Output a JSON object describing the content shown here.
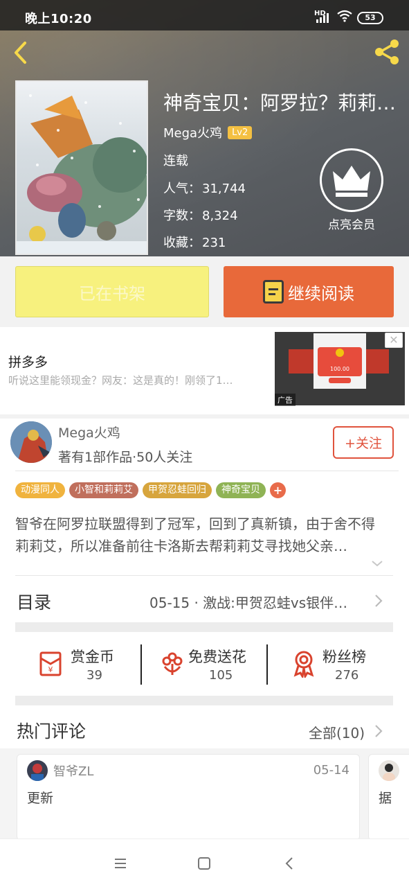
{
  "status_bar": {
    "time": "晚上10:20",
    "network": "HD",
    "battery": "53"
  },
  "book": {
    "title": "神奇宝贝：阿罗拉？莉莉…",
    "author": "Mega火鸡",
    "level": "Lv2",
    "status": "连载",
    "popularity_label": "人气：",
    "popularity": "31,744",
    "words_label": "字数：",
    "words": "8,324",
    "favorites_label": "收藏：",
    "favorites": "231",
    "vip_label": "点亮会员"
  },
  "actions": {
    "shelf_label": "已在书架",
    "read_label": "继续阅读"
  },
  "ad": {
    "title": "拼多多",
    "description": "听说这里能领现金？网友：这是真的！刚领了1…",
    "tag": "广告",
    "amount": "100.00"
  },
  "author_card": {
    "name": "Mega火鸡",
    "subtitle": "著有1部作品·50人关注",
    "follow_label": "+关注"
  },
  "tags": [
    {
      "label": "动漫同人",
      "color": "#f0b33e"
    },
    {
      "label": "小智和莉莉艾",
      "color": "#c06f5c"
    },
    {
      "label": "甲贺忍蛙回归",
      "color": "#d7a53d"
    },
    {
      "label": "神奇宝贝",
      "color": "#8fb355"
    }
  ],
  "tag_plus": "+",
  "description": "智爷在阿罗拉联盟得到了冠军，回到了真新镇，由于舍不得莉莉艾，所以准备前往卡洛斯去帮莉莉艾寻找她父亲…",
  "toc": {
    "label": "目录",
    "latest": "05-15 · 激战:甲贺忍蛙vs银伴…"
  },
  "stats": [
    {
      "label": "赏金币",
      "value": "39"
    },
    {
      "label": "免费送花",
      "value": "105"
    },
    {
      "label": "粉丝榜",
      "value": "276"
    }
  ],
  "hot_comments": {
    "label": "热门评论",
    "all_label": "全部(10)"
  },
  "comments": [
    {
      "user": "智爷ZL",
      "date": "05-14",
      "text": "更新"
    },
    {
      "user": "",
      "date": "",
      "text": "据"
    }
  ],
  "colors": {
    "accent": "#e8693a",
    "shelf": "#f7f17e",
    "follow": "#e0533d",
    "icon_red": "#d9432e"
  }
}
